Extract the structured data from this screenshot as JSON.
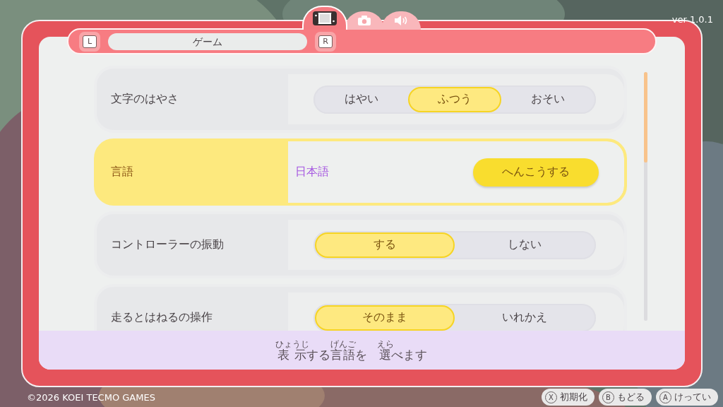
{
  "version": "ver 1.0.1",
  "tabs": [
    {
      "kind": "console",
      "selected": true
    },
    {
      "kind": "camera",
      "selected": false
    },
    {
      "kind": "sound",
      "selected": false
    }
  ],
  "header": {
    "left_key": "L",
    "title": "ゲーム",
    "right_key": "R"
  },
  "settings": [
    {
      "kind": "segmented",
      "label": "文字のはやさ",
      "selected": false,
      "options": [
        {
          "label": "はやい",
          "selected": false
        },
        {
          "label": "ふつう",
          "selected": true
        },
        {
          "label": "おそい",
          "selected": false
        }
      ]
    },
    {
      "kind": "action",
      "label": "言語",
      "selected": true,
      "value": "日本語",
      "button": "へんこうする"
    },
    {
      "kind": "segmented",
      "label": "コントローラーの振動",
      "selected": false,
      "options": [
        {
          "label": "する",
          "selected": true
        },
        {
          "label": "しない",
          "selected": false
        }
      ]
    },
    {
      "kind": "segmented",
      "label": "走るとはねるの操作",
      "selected": false,
      "options": [
        {
          "label": "そのまま",
          "selected": true
        },
        {
          "label": "いれかえ",
          "selected": false
        }
      ]
    }
  ],
  "hint": [
    {
      "text": "表示",
      "ruby": "ひょうじ"
    },
    {
      "text": "する"
    },
    {
      "text": "言語",
      "ruby": "げんご"
    },
    {
      "text": "を　"
    },
    {
      "text": "選",
      "ruby": "えら"
    },
    {
      "text": "べます"
    }
  ],
  "copyright": "©2026 KOEI TECMO GAMES",
  "footer_buttons": [
    {
      "key": "X",
      "label": "初期化"
    },
    {
      "key": "B",
      "label": "もどる"
    },
    {
      "key": "A",
      "label": "けってい"
    }
  ]
}
